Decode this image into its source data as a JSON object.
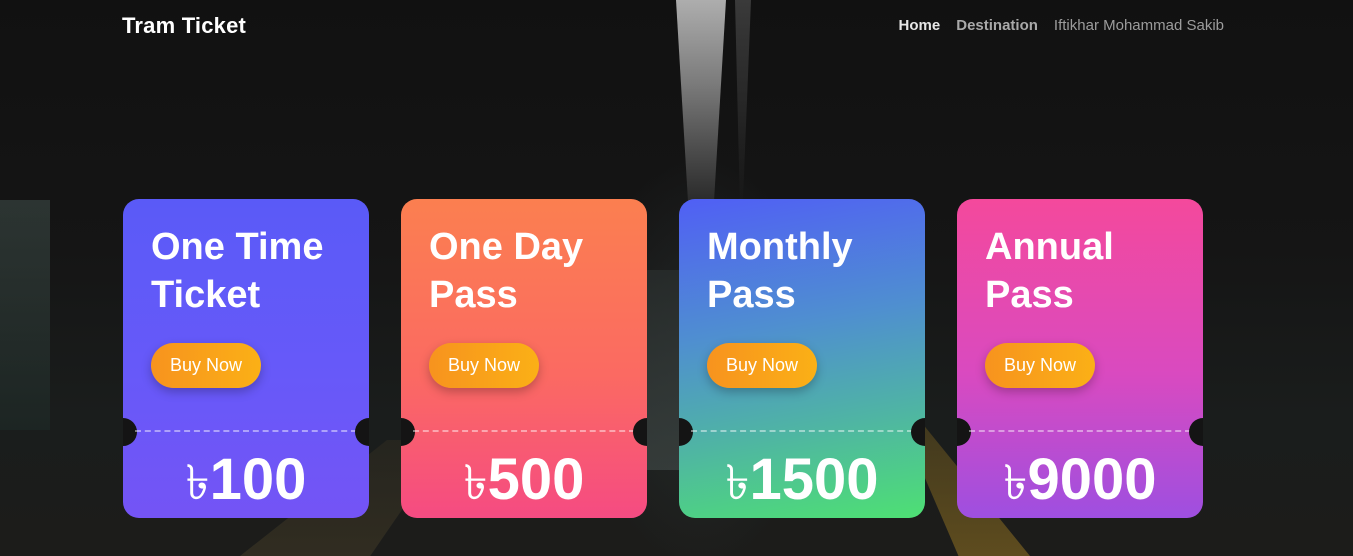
{
  "navbar": {
    "brand": "Tram Ticket",
    "links": {
      "home": "Home",
      "destination": "Destination",
      "user": "Iftikhar Mohammad Sakib"
    }
  },
  "tickets": [
    {
      "title": "One Time\nTicket",
      "button": "Buy Now",
      "currency": "৳",
      "price": "100"
    },
    {
      "title": "One Day\nPass",
      "button": "Buy Now",
      "currency": "৳",
      "price": "500"
    },
    {
      "title": "Monthly\nPass",
      "button": "Buy Now",
      "currency": "৳",
      "price": "1500"
    },
    {
      "title": "Annual\nPass",
      "button": "Buy Now",
      "currency": "৳",
      "price": "9000"
    }
  ],
  "colors": {
    "button_gradient": [
      "#f7931e",
      "#fbb016"
    ],
    "card_one_time": [
      "#5a5af7",
      "#7454f5"
    ],
    "card_one_day": [
      "#fb7f50",
      "#f54b82"
    ],
    "card_monthly": [
      "#505ff5",
      "#4ee073"
    ],
    "card_annual": [
      "#f4499c",
      "#9e4fe0"
    ]
  }
}
